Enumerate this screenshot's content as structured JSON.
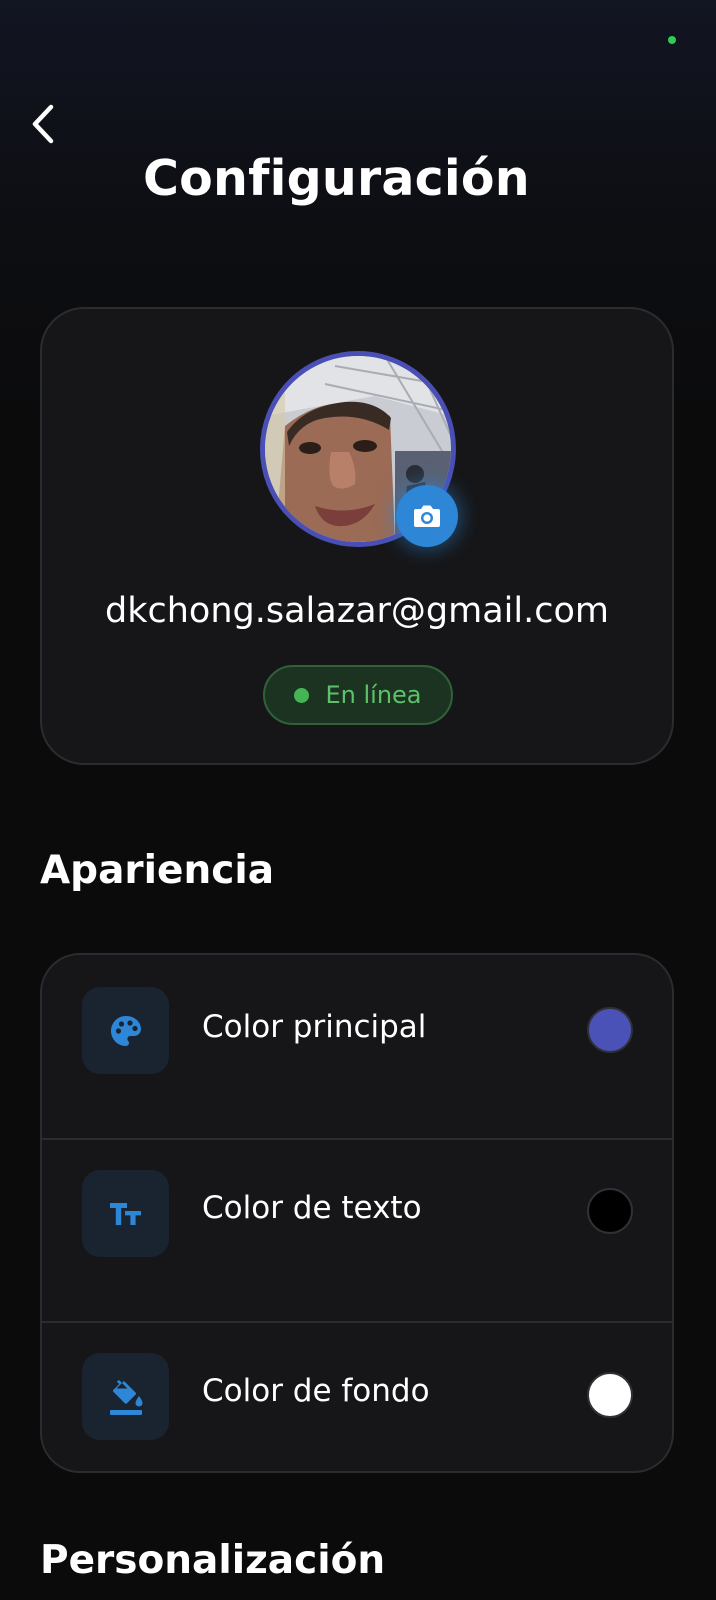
{
  "colors": {
    "accent_blue": "#2d86d6",
    "online_green": "#44b454",
    "online_text": "#5cc26a",
    "status_dot": "#2ecc55"
  },
  "header": {
    "back_icon": "chevron-left-icon",
    "title": "Configuración"
  },
  "profile": {
    "avatar": "user-photo",
    "camera_icon": "camera-icon",
    "email": "dkchong.salazar@gmail.com",
    "status_label": "En línea"
  },
  "appearance": {
    "title": "Apariencia",
    "items": [
      {
        "icon": "palette-icon",
        "label": "Color principal",
        "swatch_color": "#4a52b8"
      },
      {
        "icon": "text-size-icon",
        "label": "Color de texto",
        "swatch_color": "#000000"
      },
      {
        "icon": "fill-bucket-icon",
        "label": "Color de fondo",
        "swatch_color": "#ffffff"
      }
    ]
  },
  "personalization": {
    "title": "Personalización"
  }
}
